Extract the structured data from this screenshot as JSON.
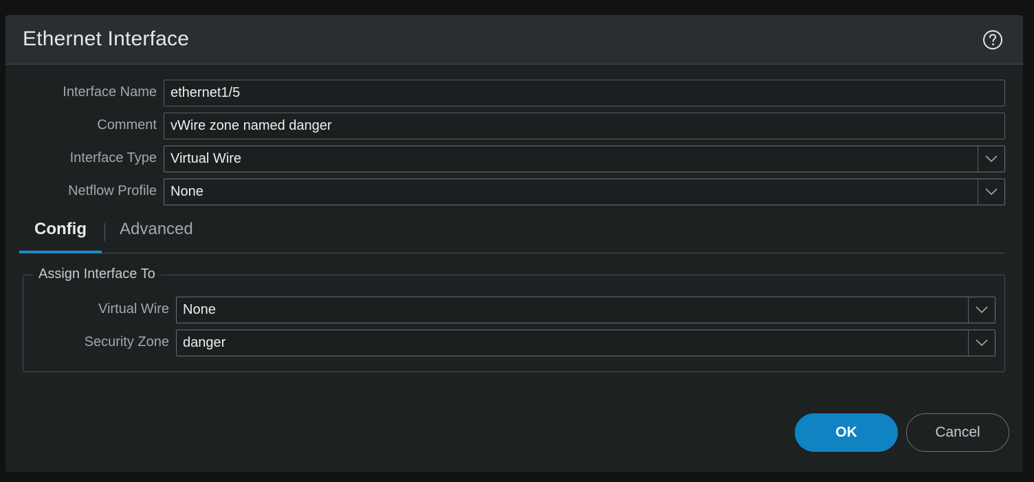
{
  "dialog": {
    "title": "Ethernet Interface",
    "help_icon": "help-circle-icon"
  },
  "form": {
    "interface_name": {
      "label": "Interface Name",
      "value": "ethernet1/5"
    },
    "comment": {
      "label": "Comment",
      "value": "vWire zone named danger"
    },
    "interface_type": {
      "label": "Interface Type",
      "value": "Virtual Wire"
    },
    "netflow_profile": {
      "label": "Netflow Profile",
      "value": "None"
    }
  },
  "tabs": {
    "config": "Config",
    "advanced": "Advanced",
    "active": "Config"
  },
  "assign_group": {
    "legend": "Assign Interface To",
    "virtual_wire": {
      "label": "Virtual Wire",
      "value": "None"
    },
    "security_zone": {
      "label": "Security Zone",
      "value": "danger"
    }
  },
  "buttons": {
    "ok": "OK",
    "cancel": "Cancel"
  },
  "colors": {
    "accent": "#1083c2",
    "background": "#1e2122",
    "header": "#2b2e30"
  }
}
